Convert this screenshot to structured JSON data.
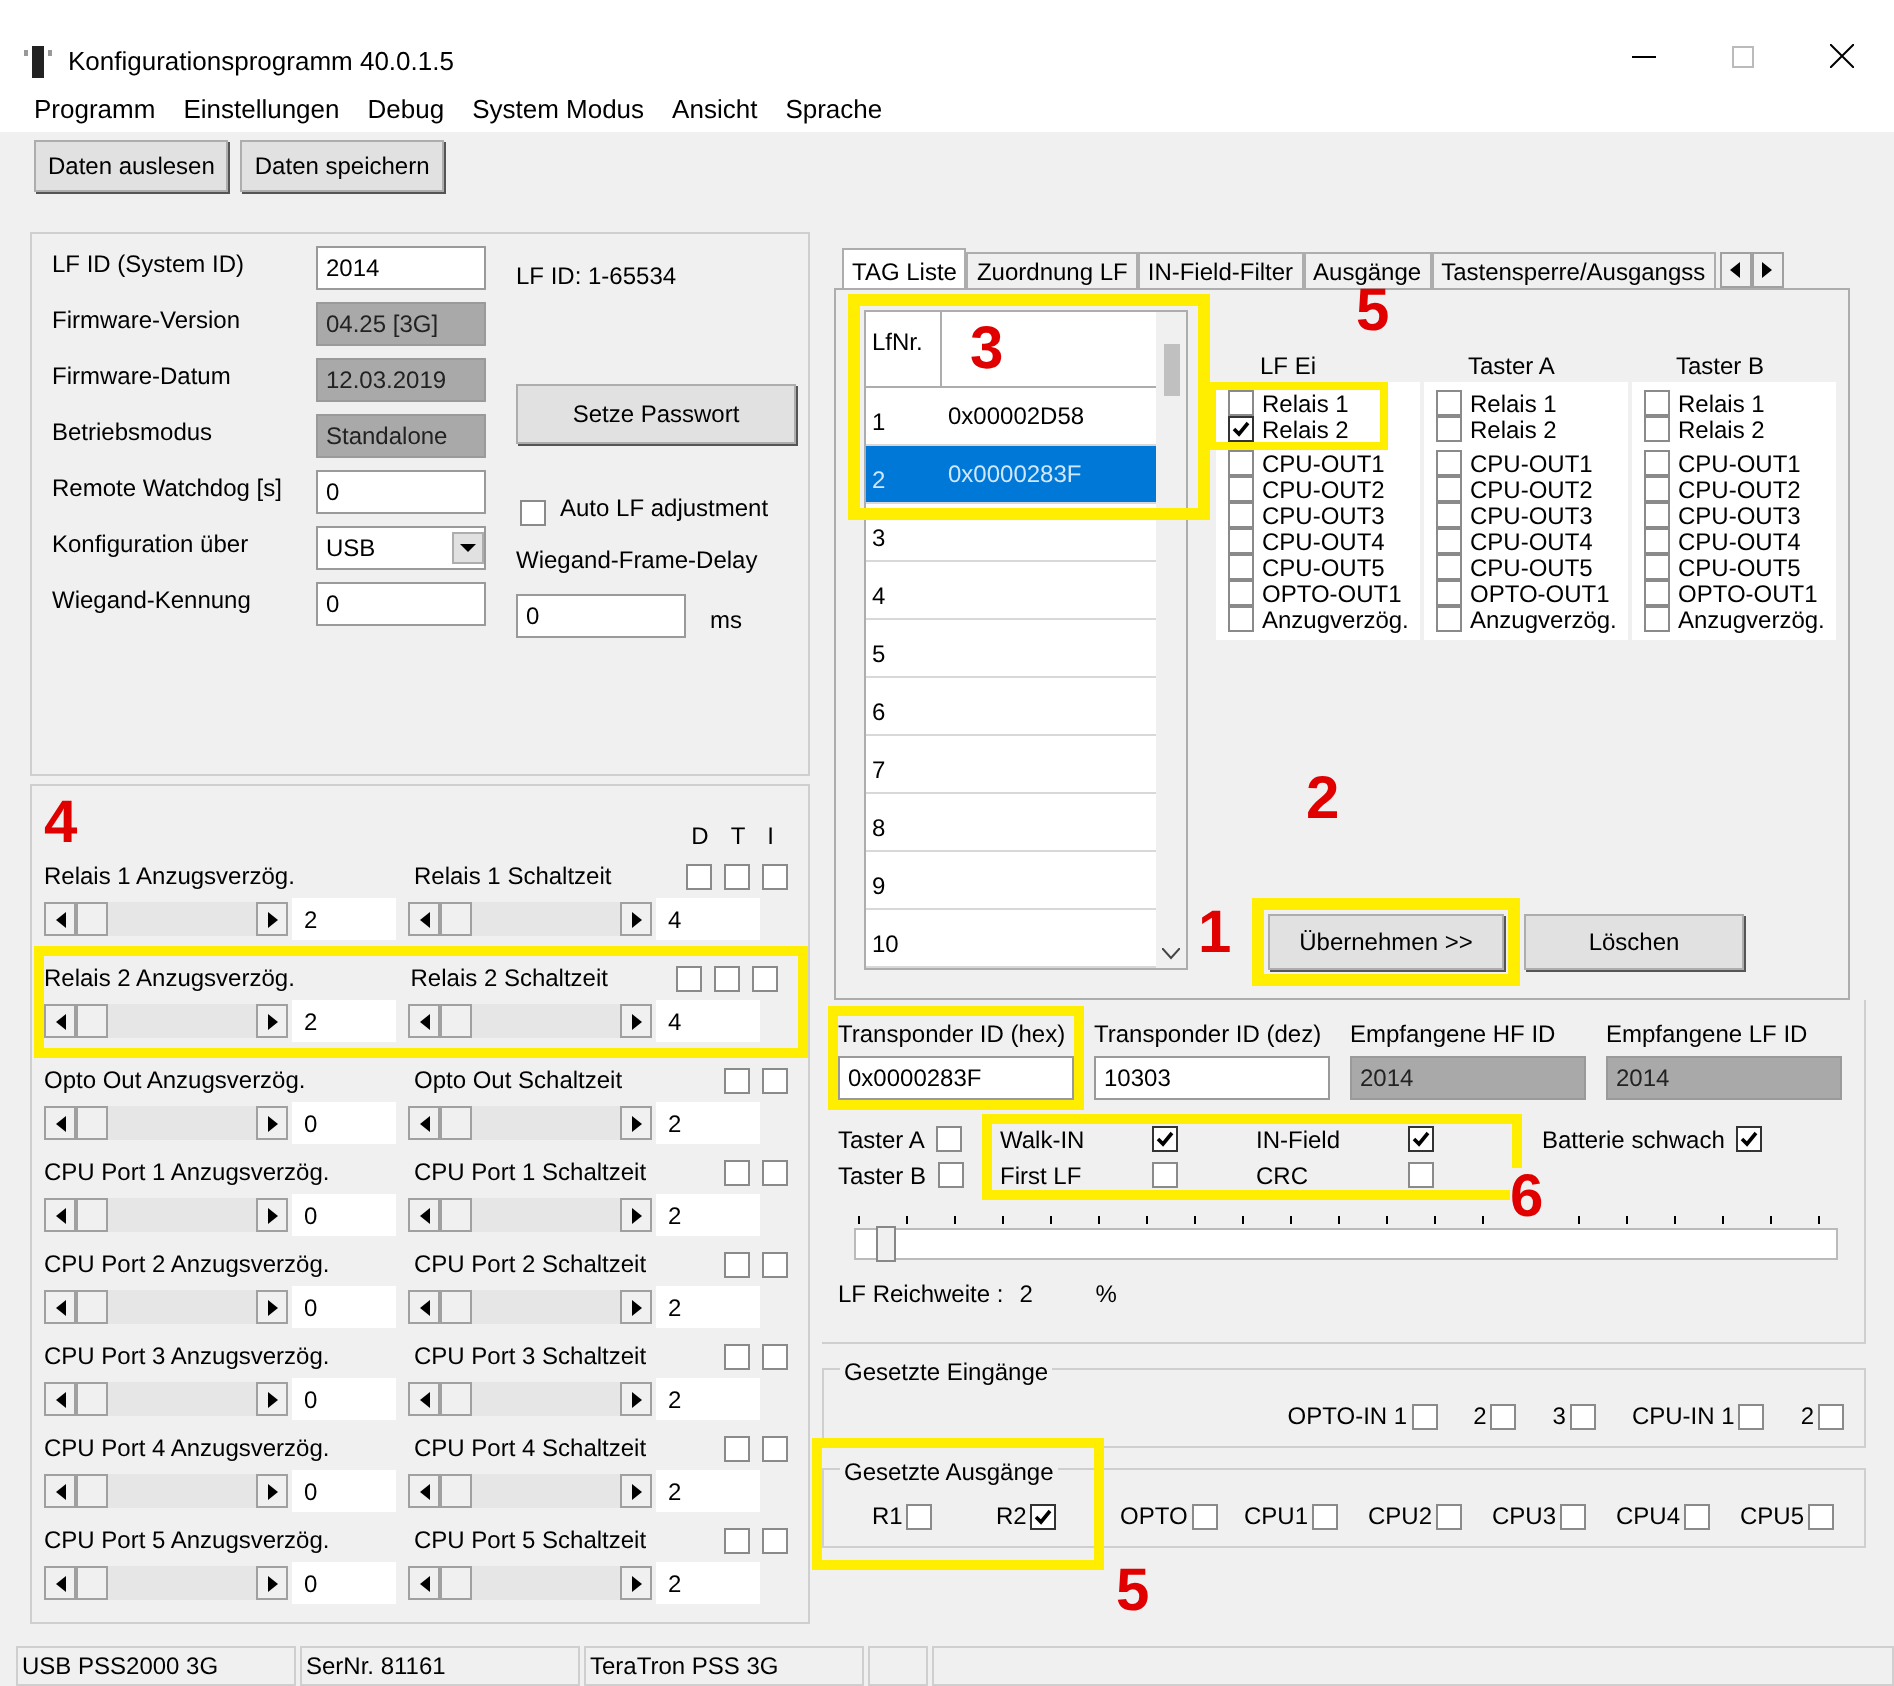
{
  "window": {
    "title": "Konfigurationsprogramm 40.0.1.5"
  },
  "menu": [
    "Programm",
    "Einstellungen",
    "Debug",
    "System Modus",
    "Ansicht",
    "Sprache"
  ],
  "toolbar": [
    "Daten auslesen",
    "Daten speichern"
  ],
  "settings": {
    "fields": [
      {
        "label": "LF ID (System ID)",
        "value": "2014",
        "kind": "input"
      },
      {
        "label": "Firmware-Version",
        "value": "04.25 [3G]",
        "kind": "readonly"
      },
      {
        "label": "Firmware-Datum",
        "value": "12.03.2019",
        "kind": "readonly"
      },
      {
        "label": "Betriebsmodus",
        "value": "Standalone",
        "kind": "readonly"
      },
      {
        "label": "Remote Watchdog [s]",
        "value": "0",
        "kind": "input"
      },
      {
        "label": "Konfiguration über",
        "value": "USB",
        "kind": "select"
      },
      {
        "label": "Wiegand-Kennung",
        "value": "0",
        "kind": "input"
      }
    ],
    "range_note": "LF ID: 1-65534",
    "password_button": "Setze Passwort",
    "auto_lf": {
      "label": "Auto LF adjustment",
      "checked": false
    },
    "delay": {
      "label": "Wiegand-Frame-Delay",
      "value": "0",
      "unit": "ms"
    }
  },
  "timing": {
    "headers": [
      "D",
      "T",
      "I"
    ],
    "rows": [
      {
        "delay_label": "Relais 1 Anzugsverzög.",
        "delay_value": "2",
        "switch_label": "Relais 1 Schaltzeit",
        "switch_value": "4",
        "flags": [
          {
            "checked": false
          },
          {
            "checked": false
          },
          {
            "checked": false
          }
        ]
      },
      {
        "delay_label": "Relais 2 Anzugsverzög.",
        "delay_value": "2",
        "switch_label": "Relais 2 Schaltzeit",
        "switch_value": "4",
        "flags": [
          {
            "checked": false
          },
          {
            "checked": false
          },
          {
            "checked": false
          }
        ]
      },
      {
        "delay_label": "Opto Out Anzugsverzög.",
        "delay_value": "0",
        "switch_label": "Opto Out Schaltzeit",
        "switch_value": "2",
        "flags": [
          {
            "checked": false
          },
          {
            "checked": false
          }
        ]
      },
      {
        "delay_label": "CPU Port 1 Anzugsverzög.",
        "delay_value": "0",
        "switch_label": "CPU Port 1 Schaltzeit",
        "switch_value": "2",
        "flags": [
          {
            "checked": false
          },
          {
            "checked": false
          }
        ]
      },
      {
        "delay_label": "CPU Port 2 Anzugsverzög.",
        "delay_value": "0",
        "switch_label": "CPU Port 2 Schaltzeit",
        "switch_value": "2",
        "flags": [
          {
            "checked": false
          },
          {
            "checked": false
          }
        ]
      },
      {
        "delay_label": "CPU Port 3 Anzugsverzög.",
        "delay_value": "0",
        "switch_label": "CPU Port 3 Schaltzeit",
        "switch_value": "2",
        "flags": [
          {
            "checked": false
          },
          {
            "checked": false
          }
        ]
      },
      {
        "delay_label": "CPU Port 4 Anzugsverzög.",
        "delay_value": "0",
        "switch_label": "CPU Port 4 Schaltzeit",
        "switch_value": "2",
        "flags": [
          {
            "checked": false
          },
          {
            "checked": false
          }
        ]
      },
      {
        "delay_label": "CPU Port 5 Anzugsverzög.",
        "delay_value": "0",
        "switch_label": "CPU Port 5 Schaltzeit",
        "switch_value": "2",
        "flags": [
          {
            "checked": false
          },
          {
            "checked": false
          }
        ]
      }
    ]
  },
  "tabs": [
    {
      "label": "TAG Liste",
      "selected": true
    },
    {
      "label": "Zuordnung LF",
      "selected": false
    },
    {
      "label": "IN-Field-Filter",
      "selected": false
    },
    {
      "label": "Ausgänge",
      "selected": false
    },
    {
      "label": "Tastensperre/Ausgangss",
      "selected": false
    }
  ],
  "tag_list": {
    "columns": [
      "LfNr."
    ],
    "rows": [
      {
        "no": "1",
        "id": "0x00002D58",
        "selected": false
      },
      {
        "no": "2",
        "id": "0x0000283F",
        "selected": true
      },
      {
        "no": "3",
        "selected": false
      },
      {
        "no": "4",
        "selected": false
      },
      {
        "no": "5",
        "selected": false
      },
      {
        "no": "6",
        "selected": false
      },
      {
        "no": "7",
        "selected": false
      },
      {
        "no": "8",
        "selected": false
      },
      {
        "no": "9",
        "selected": false
      },
      {
        "no": "10",
        "selected": false
      }
    ]
  },
  "assignments": [
    {
      "title": "LF Ei",
      "items": [
        {
          "label": "Relais 1",
          "checked": false
        },
        {
          "label": "Relais 2",
          "checked": true
        },
        {
          "label": "CPU-OUT1",
          "checked": false
        },
        {
          "label": "CPU-OUT2",
          "checked": false
        },
        {
          "label": "CPU-OUT3",
          "checked": false
        },
        {
          "label": "CPU-OUT4",
          "checked": false
        },
        {
          "label": "CPU-OUT5",
          "checked": false
        },
        {
          "label": "OPTO-OUT1",
          "checked": false
        },
        {
          "label": "Anzugverzög.",
          "checked": false
        }
      ]
    },
    {
      "title": "Taster A",
      "items": [
        {
          "label": "Relais 1",
          "checked": false
        },
        {
          "label": "Relais 2",
          "checked": false
        },
        {
          "label": "CPU-OUT1",
          "checked": false
        },
        {
          "label": "CPU-OUT2",
          "checked": false
        },
        {
          "label": "CPU-OUT3",
          "checked": false
        },
        {
          "label": "CPU-OUT4",
          "checked": false
        },
        {
          "label": "CPU-OUT5",
          "checked": false
        },
        {
          "label": "OPTO-OUT1",
          "checked": false
        },
        {
          "label": "Anzugverzög.",
          "checked": false
        }
      ]
    },
    {
      "title": "Taster B",
      "items": [
        {
          "label": "Relais 1",
          "checked": false
        },
        {
          "label": "Relais 2",
          "checked": false
        },
        {
          "label": "CPU-OUT1",
          "checked": false
        },
        {
          "label": "CPU-OUT2",
          "checked": false
        },
        {
          "label": "CPU-OUT3",
          "checked": false
        },
        {
          "label": "CPU-OUT4",
          "checked": false
        },
        {
          "label": "CPU-OUT5",
          "checked": false
        },
        {
          "label": "OPTO-OUT1",
          "checked": false
        },
        {
          "label": "Anzugverzög.",
          "checked": false
        }
      ]
    }
  ],
  "tag_buttons": [
    "Übernehmen >>",
    "Löschen"
  ],
  "transponder": [
    {
      "label": "Transponder ID (hex)",
      "value": "0x0000283F",
      "kind": "input"
    },
    {
      "label": "Transponder ID (dez)",
      "value": "10303",
      "kind": "input"
    },
    {
      "label": "Empfangene HF ID",
      "value": "2014",
      "kind": "readonly"
    },
    {
      "label": "Empfangene LF ID",
      "value": "2014",
      "kind": "readonly"
    }
  ],
  "flags": [
    [
      {
        "label": "Taster A",
        "checked": false
      },
      {
        "label": "Walk-IN",
        "checked": true
      },
      {
        "label": "IN-Field",
        "checked": true
      },
      {
        "label": "Batterie schwach",
        "checked": true
      }
    ],
    [
      {
        "label": "Taster B",
        "checked": false
      },
      {
        "label": "First LF",
        "checked": false
      },
      {
        "label": "CRC",
        "checked": false
      }
    ]
  ],
  "range": {
    "level": 0.02,
    "label": "LF Reichweite :",
    "value": "2",
    "unit": "%"
  },
  "inputs": {
    "title": "Gesetzte Eingänge",
    "items": [
      {
        "label": "OPTO-IN 1",
        "checked": false
      },
      {
        "label": "2",
        "checked": false
      },
      {
        "label": "3",
        "checked": false
      },
      {
        "label": "CPU-IN 1",
        "checked": false
      },
      {
        "label": "2",
        "checked": false
      }
    ]
  },
  "outputs": {
    "title": "Gesetzte Ausgänge",
    "items": [
      {
        "label": "R1",
        "checked": false
      },
      {
        "label": "R2",
        "checked": true
      },
      {
        "label": "OPTO",
        "checked": false
      },
      {
        "label": "CPU1",
        "checked": false
      },
      {
        "label": "CPU2",
        "checked": false
      },
      {
        "label": "CPU3",
        "checked": false
      },
      {
        "label": "CPU4",
        "checked": false
      },
      {
        "label": "CPU5",
        "checked": false
      }
    ]
  },
  "status_bar": [
    "USB PSS2000 3G",
    "SerNr. 81161",
    "TeraTron PSS 3G"
  ],
  "annotations": [
    "3",
    "5",
    "2",
    "1",
    "4",
    "6",
    "5"
  ]
}
